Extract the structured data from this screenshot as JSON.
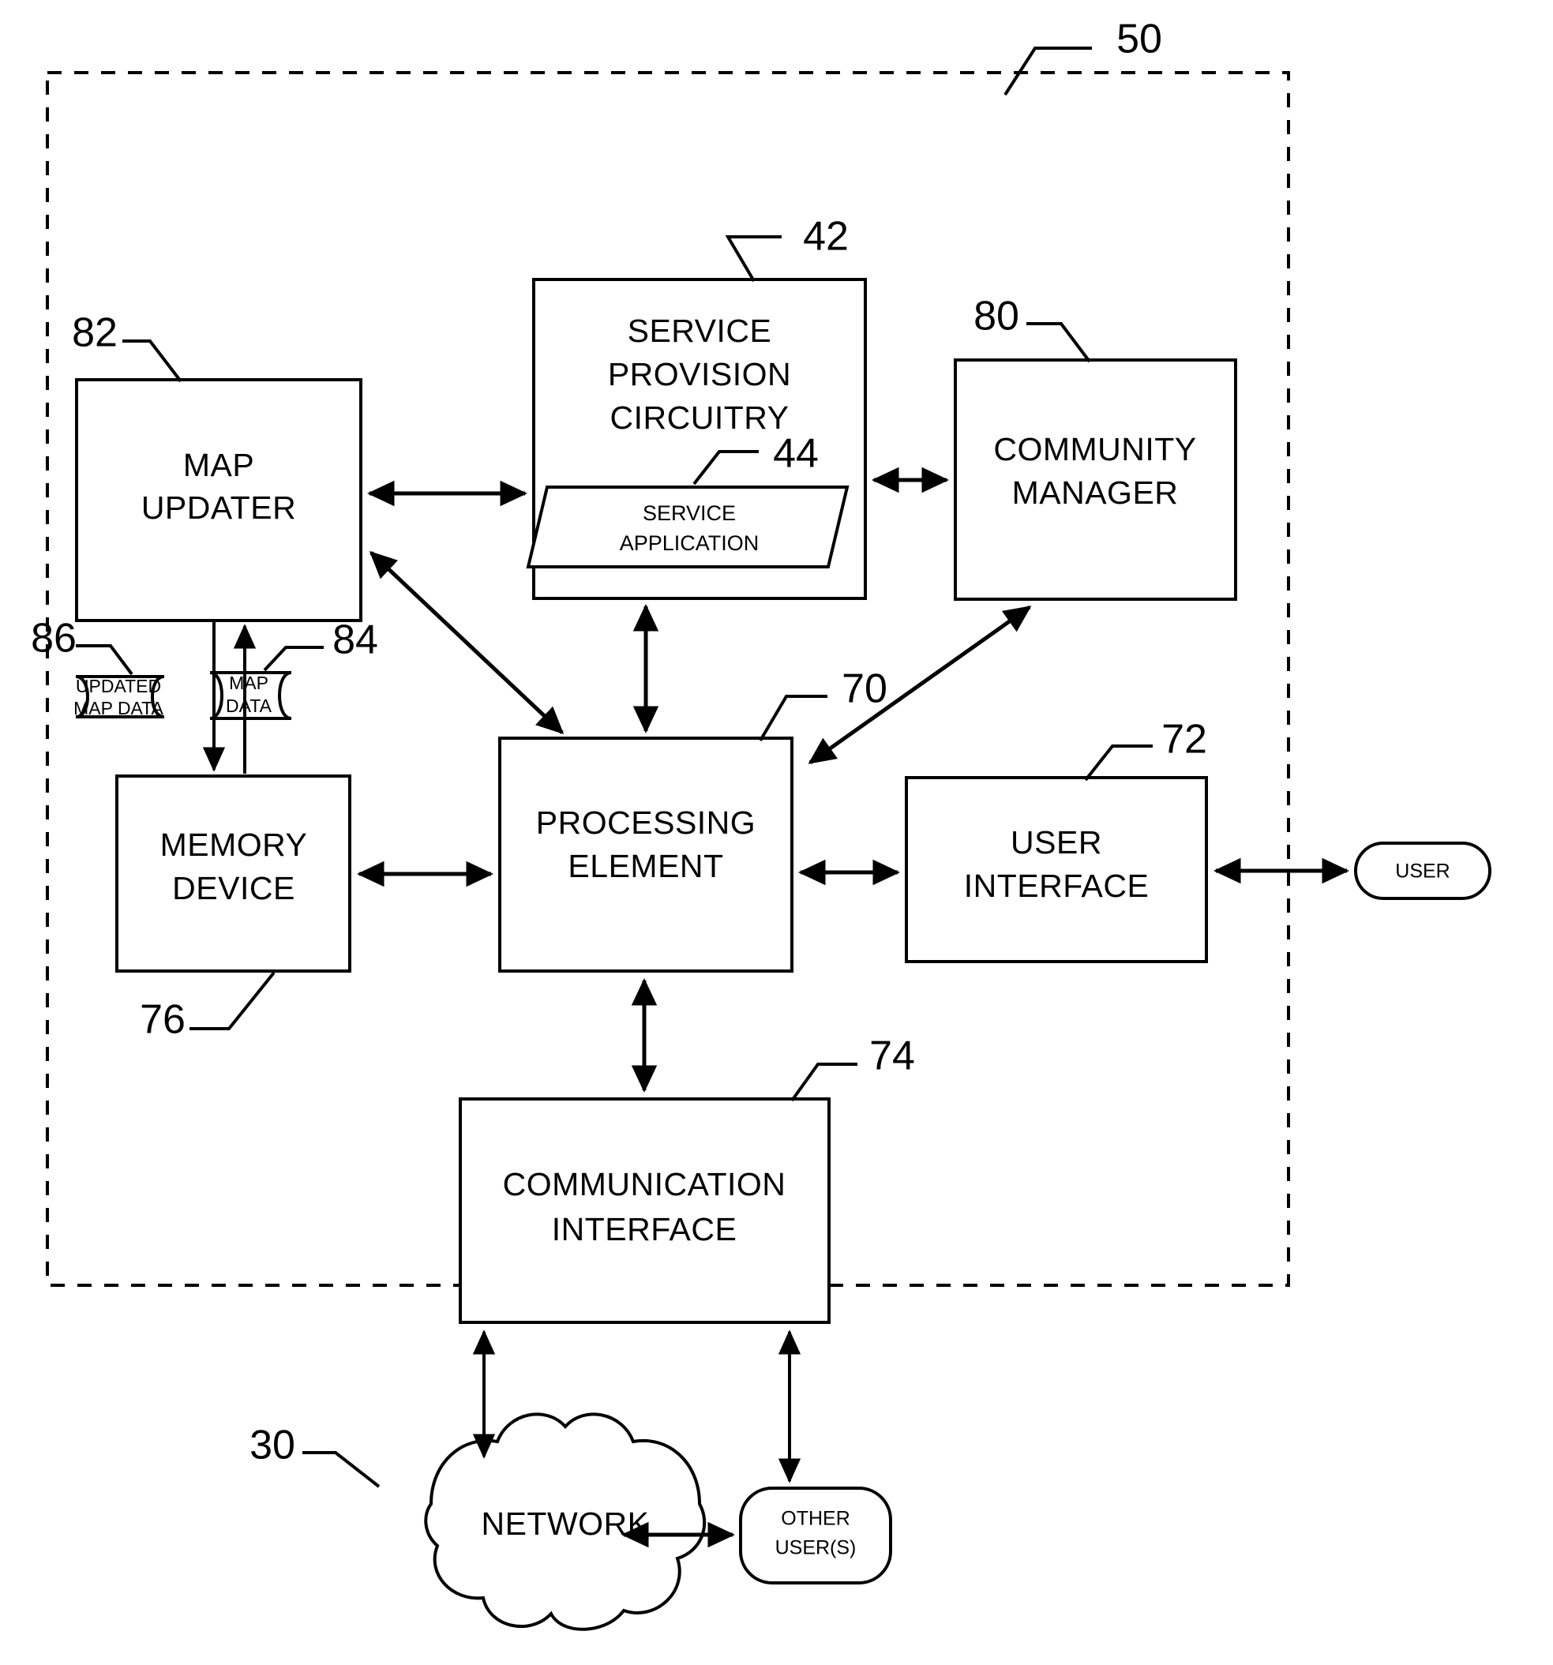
{
  "figure": {
    "title": "System architecture block diagram",
    "system_boundary_ref": "50"
  },
  "blocks": {
    "map_updater": {
      "label_line1": "MAP",
      "label_line2": "UPDATER",
      "ref": "82"
    },
    "service_provision": {
      "label_line1": "SERVICE",
      "label_line2": "PROVISION",
      "label_line3": "CIRCUITRY",
      "ref": "42"
    },
    "service_application": {
      "label_line1": "SERVICE",
      "label_line2": "APPLICATION",
      "ref": "44"
    },
    "community_manager": {
      "label_line1": "COMMUNITY",
      "label_line2": "MANAGER",
      "ref": "80"
    },
    "processing_element": {
      "label_line1": "PROCESSING",
      "label_line2": "ELEMENT",
      "ref": "70"
    },
    "memory_device": {
      "label_line1": "MEMORY",
      "label_line2": "DEVICE",
      "ref": "76"
    },
    "user_interface": {
      "label_line1": "USER",
      "label_line2": "INTERFACE",
      "ref": "72"
    },
    "communication_interface": {
      "label_line1": "COMMUNICATION",
      "label_line2": "INTERFACE",
      "ref": "74"
    }
  },
  "data_stores": {
    "updated_map_data": {
      "label_line1": "UPDATED",
      "label_line2": "MAP DATA",
      "ref": "86"
    },
    "map_data": {
      "label_line1": "MAP",
      "label_line2": "DATA",
      "ref": "84"
    }
  },
  "actors": {
    "user": {
      "label": "USER"
    },
    "other_users": {
      "label_line1": "OTHER",
      "label_line2": "USER(S)",
      "ref": ""
    },
    "network": {
      "label": "NETWORK",
      "ref": "30"
    }
  },
  "reference_numerals": {
    "system": "50",
    "service_provision_circuitry": "42",
    "service_application": "44",
    "map_updater": "82",
    "community_manager": "80",
    "updated_map_data": "86",
    "map_data": "84",
    "processing_element": "70",
    "memory_device": "76",
    "user_interface": "72",
    "communication_interface": "74",
    "network": "30"
  },
  "colors": {
    "line": "#000000",
    "fill": "#ffffff"
  }
}
